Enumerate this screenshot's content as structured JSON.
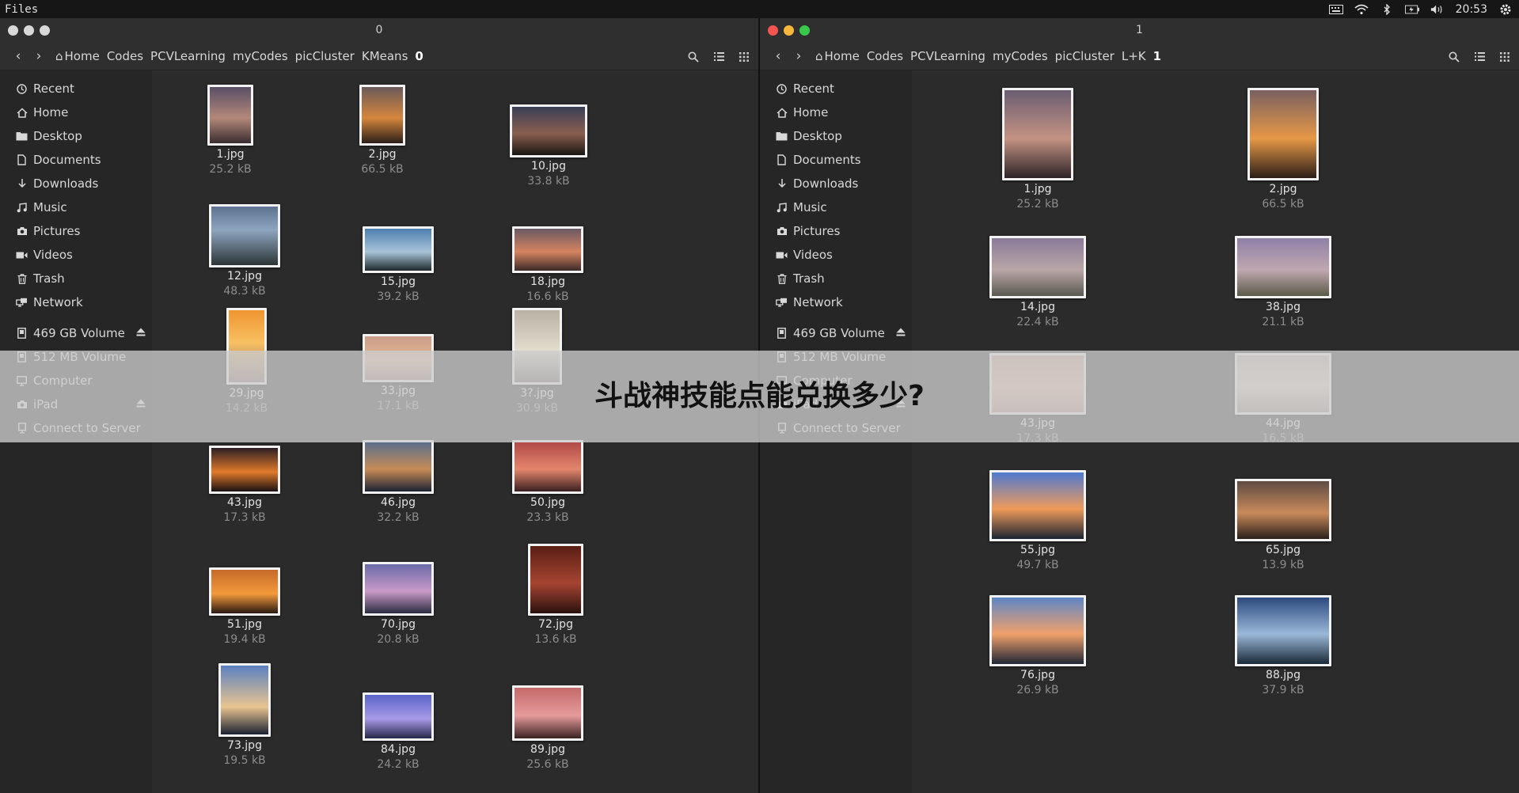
{
  "topbar": {
    "app": "Files",
    "time": "20:53"
  },
  "left": {
    "title": "0",
    "crumbs": [
      "Home",
      "Codes",
      "PCVLearning",
      "myCodes",
      "picCluster",
      "KMeans"
    ],
    "current": "0",
    "files": [
      {
        "name": "1.jpg",
        "size": "25.2 kB"
      },
      {
        "name": "2.jpg",
        "size": "66.5 kB"
      },
      {
        "name": "10.jpg",
        "size": "33.8 kB"
      },
      {
        "name": "12.jpg",
        "size": "48.3 kB"
      },
      {
        "name": "15.jpg",
        "size": "39.2 kB"
      },
      {
        "name": "18.jpg",
        "size": "16.6 kB"
      },
      {
        "name": "29.jpg",
        "size": "14.2 kB"
      },
      {
        "name": "33.jpg",
        "size": "17.1 kB"
      },
      {
        "name": "3?.jpg",
        "size": "30.9 kB"
      },
      {
        "name": "43.jpg",
        "size": "17.3 kB"
      },
      {
        "name": "46.jpg",
        "size": "32.2 kB"
      },
      {
        "name": "50.jpg",
        "size": "23.3 kB"
      },
      {
        "name": "51.jpg",
        "size": "19.4 kB"
      },
      {
        "name": "70.jpg",
        "size": "20.8 kB"
      },
      {
        "name": "72.jpg",
        "size": "13.6 kB"
      },
      {
        "name": "73.jpg",
        "size": "19.5 kB"
      },
      {
        "name": "84.jpg",
        "size": "24.2 kB"
      },
      {
        "name": "89.jpg",
        "size": "25.6 kB"
      }
    ]
  },
  "right": {
    "title": "1",
    "crumbs": [
      "Home",
      "Codes",
      "PCVLearning",
      "myCodes",
      "picCluster",
      "L+K"
    ],
    "current": "1",
    "files": [
      {
        "name": "1.jpg",
        "size": "25.2 kB"
      },
      {
        "name": "2.jpg",
        "size": "66.5 kB"
      },
      {
        "name": "14.jpg",
        "size": "22.4 kB"
      },
      {
        "name": "38.jpg",
        "size": "21.1 kB"
      },
      {
        "name": "43.jpg",
        "size": "17.3 kB"
      },
      {
        "name": "44.jpg",
        "size": "16.5 kB"
      },
      {
        "name": "55.jpg",
        "size": "49.7 kB"
      },
      {
        "name": "65.jpg",
        "size": "13.9 kB"
      },
      {
        "name": "76.jpg",
        "size": "26.9 kB"
      },
      {
        "name": "88.jpg",
        "size": "37.9 kB"
      }
    ]
  },
  "sidebar": {
    "places": [
      {
        "label": "Recent",
        "icon": "clock-icon"
      },
      {
        "label": "Home",
        "icon": "home-icon"
      },
      {
        "label": "Desktop",
        "icon": "folder-icon"
      },
      {
        "label": "Documents",
        "icon": "document-icon"
      },
      {
        "label": "Downloads",
        "icon": "download-icon"
      },
      {
        "label": "Music",
        "icon": "music-icon"
      },
      {
        "label": "Pictures",
        "icon": "camera-icon"
      },
      {
        "label": "Videos",
        "icon": "video-icon"
      },
      {
        "label": "Trash",
        "icon": "trash-icon"
      },
      {
        "label": "Network",
        "icon": "network-icon"
      }
    ],
    "devices": [
      {
        "label": "469 GB Volume",
        "icon": "drive-icon",
        "eject": true
      },
      {
        "label": "512 MB Volume",
        "icon": "drive-icon",
        "eject": false
      },
      {
        "label": "Computer",
        "icon": "computer-icon",
        "eject": false
      },
      {
        "label": "iPad",
        "icon": "camera-icon",
        "eject": true
      },
      {
        "label": "Connect to Server",
        "icon": "server-icon",
        "eject": false
      }
    ]
  },
  "banner": {
    "text": "斗战神技能点能兑换多少?"
  },
  "colors": {
    "close": "#f2544f",
    "minimize": "#f5b83a",
    "maximize": "#38c94a",
    "background": "#2b2b2b",
    "sidebar": "#262626"
  }
}
